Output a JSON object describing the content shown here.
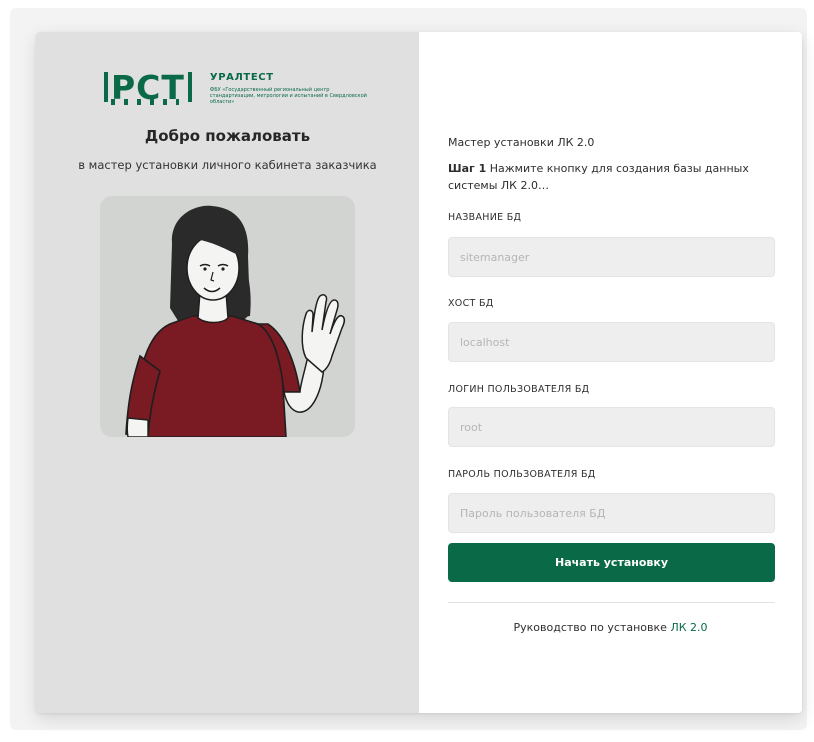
{
  "brand": {
    "mark": "РСТ",
    "title": "УРАЛТЕСТ",
    "subtitle": "ФБУ «Государственный региональный центр стандартизации, метрологии и испытаний в Свердловской области»"
  },
  "welcome": {
    "title": "Добро пожаловать",
    "subtitle": "в мастер установки личного кабинета заказчика"
  },
  "wizard": {
    "title": "Мастер установки ЛК 2.0",
    "step_label": "Шаг 1",
    "step_text": "Нажмите кнопку для создания базы данных системы ЛК 2.0…"
  },
  "form": {
    "db_name": {
      "label": "НАЗВАНИЕ БД",
      "value": "",
      "placeholder": "sitemanager"
    },
    "db_host": {
      "label": "ХОСТ БД",
      "value": "",
      "placeholder": "localhost"
    },
    "db_user": {
      "label": "ЛОГИН ПОЛЬЗОВАТЕЛЯ БД",
      "value": "",
      "placeholder": "root"
    },
    "db_password": {
      "label": "ПАРОЛЬ ПОЛЬЗОВАТЕЛЯ БД",
      "value": "",
      "placeholder": "Пароль пользователя БД"
    },
    "submit_label": "Начать установку"
  },
  "guide": {
    "text": "Руководство по установке",
    "link": "ЛК 2.0"
  },
  "colors": {
    "accent": "#0a6a48",
    "left_panel": "#e0e0e0",
    "input_bg": "#eeeeee",
    "shirt": "#7a1a23"
  },
  "icons": {
    "illustration": "waving-woman-illustration"
  }
}
